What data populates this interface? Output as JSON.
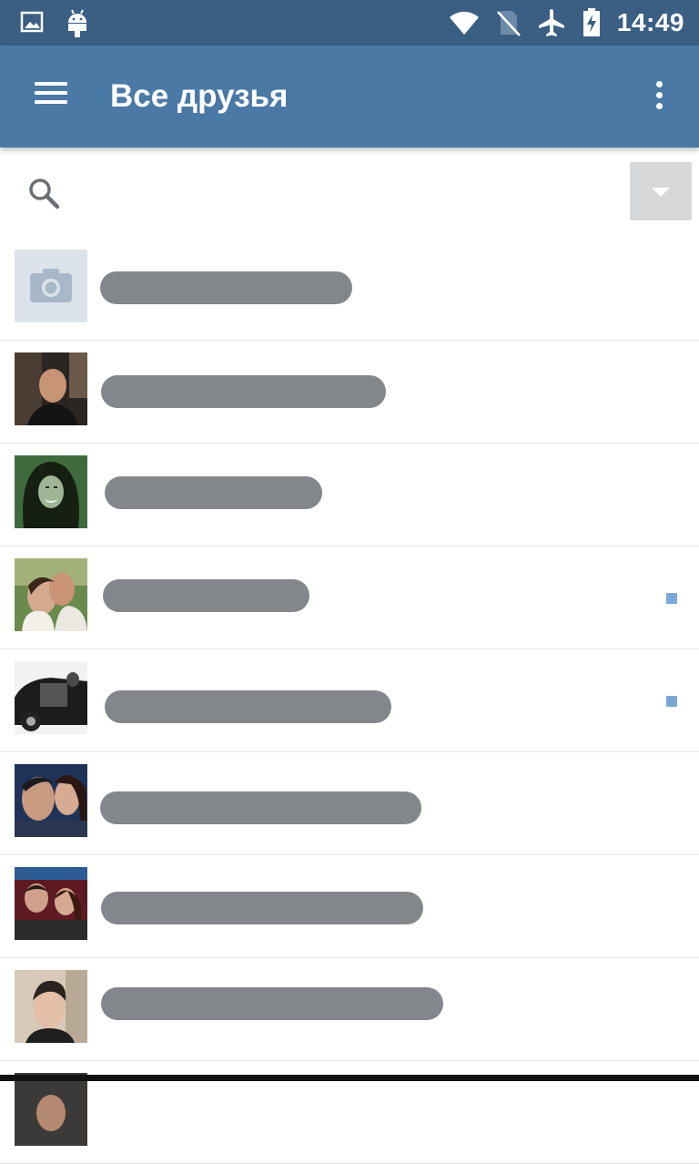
{
  "status_bar": {
    "time": "14:49",
    "icons": [
      "image-icon",
      "android-icon",
      "wifi-icon",
      "no-sim-icon",
      "airplane-icon",
      "battery-charging-icon"
    ]
  },
  "app_bar": {
    "title": "Все друзья",
    "icons": [
      "hamburger-menu-icon",
      "overflow-menu-icon"
    ]
  },
  "search": {
    "placeholder": "",
    "value": "",
    "icon": "search-icon",
    "filter_icon": "chevron-down-icon"
  },
  "colors": {
    "status_bar": "#3a5f83",
    "app_bar": "#4a79a6",
    "online_indicator": "#7aa8d6",
    "redaction": "#83878c"
  },
  "friends": [
    {
      "avatar": "camera-placeholder-icon",
      "online": false
    },
    {
      "avatar": "avatar-photo",
      "online": false
    },
    {
      "avatar": "avatar-photo",
      "online": false
    },
    {
      "avatar": "avatar-photo",
      "online": true
    },
    {
      "avatar": "avatar-photo",
      "online": true
    },
    {
      "avatar": "avatar-photo",
      "online": false
    },
    {
      "avatar": "avatar-photo",
      "online": false
    },
    {
      "avatar": "avatar-photo",
      "online": false
    },
    {
      "avatar": "avatar-photo",
      "online": false
    }
  ]
}
